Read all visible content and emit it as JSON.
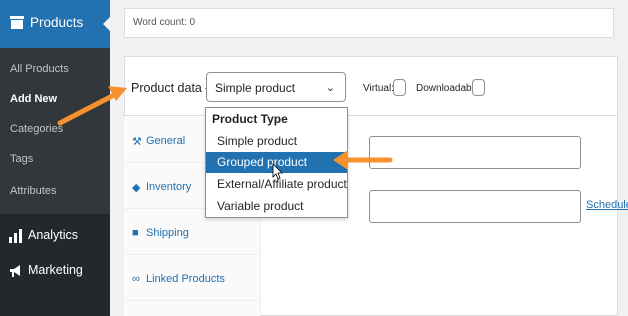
{
  "sidebar": {
    "header": {
      "label": "Products",
      "icon": "products-icon"
    },
    "submenu": [
      {
        "label": "All Products",
        "current": false
      },
      {
        "label": "Add New",
        "current": true
      },
      {
        "label": "Categories",
        "current": false
      },
      {
        "label": "Tags",
        "current": false
      },
      {
        "label": "Attributes",
        "current": false
      }
    ],
    "menu": [
      {
        "label": "Analytics",
        "icon": "bar-chart-icon"
      },
      {
        "label": "Marketing",
        "icon": "megaphone-icon"
      }
    ]
  },
  "editor": {
    "word_count": "Word count: 0"
  },
  "product_data": {
    "label": "Product data —",
    "select_value": "Simple product",
    "virtual_label": "Virtual:",
    "downloadable_label": "Downloadable:",
    "dropdown": {
      "group_label": "Product Type",
      "options": [
        "Simple product",
        "Grouped product",
        "External/Affiliate product",
        "Variable product"
      ],
      "highlighted": "Grouped product"
    },
    "tabs": [
      {
        "label": "General",
        "icon": "wrench-icon"
      },
      {
        "label": "Inventory",
        "icon": "tag-icon"
      },
      {
        "label": "Shipping",
        "icon": "truck-icon"
      },
      {
        "label": "Linked Products",
        "icon": "link-icon"
      }
    ],
    "schedule_link": "Schedule"
  },
  "colors": {
    "sidebar": "#23282d",
    "submenu": "#32373c",
    "accent": "#2271b1",
    "annotation_arrow": "#f5922f"
  }
}
